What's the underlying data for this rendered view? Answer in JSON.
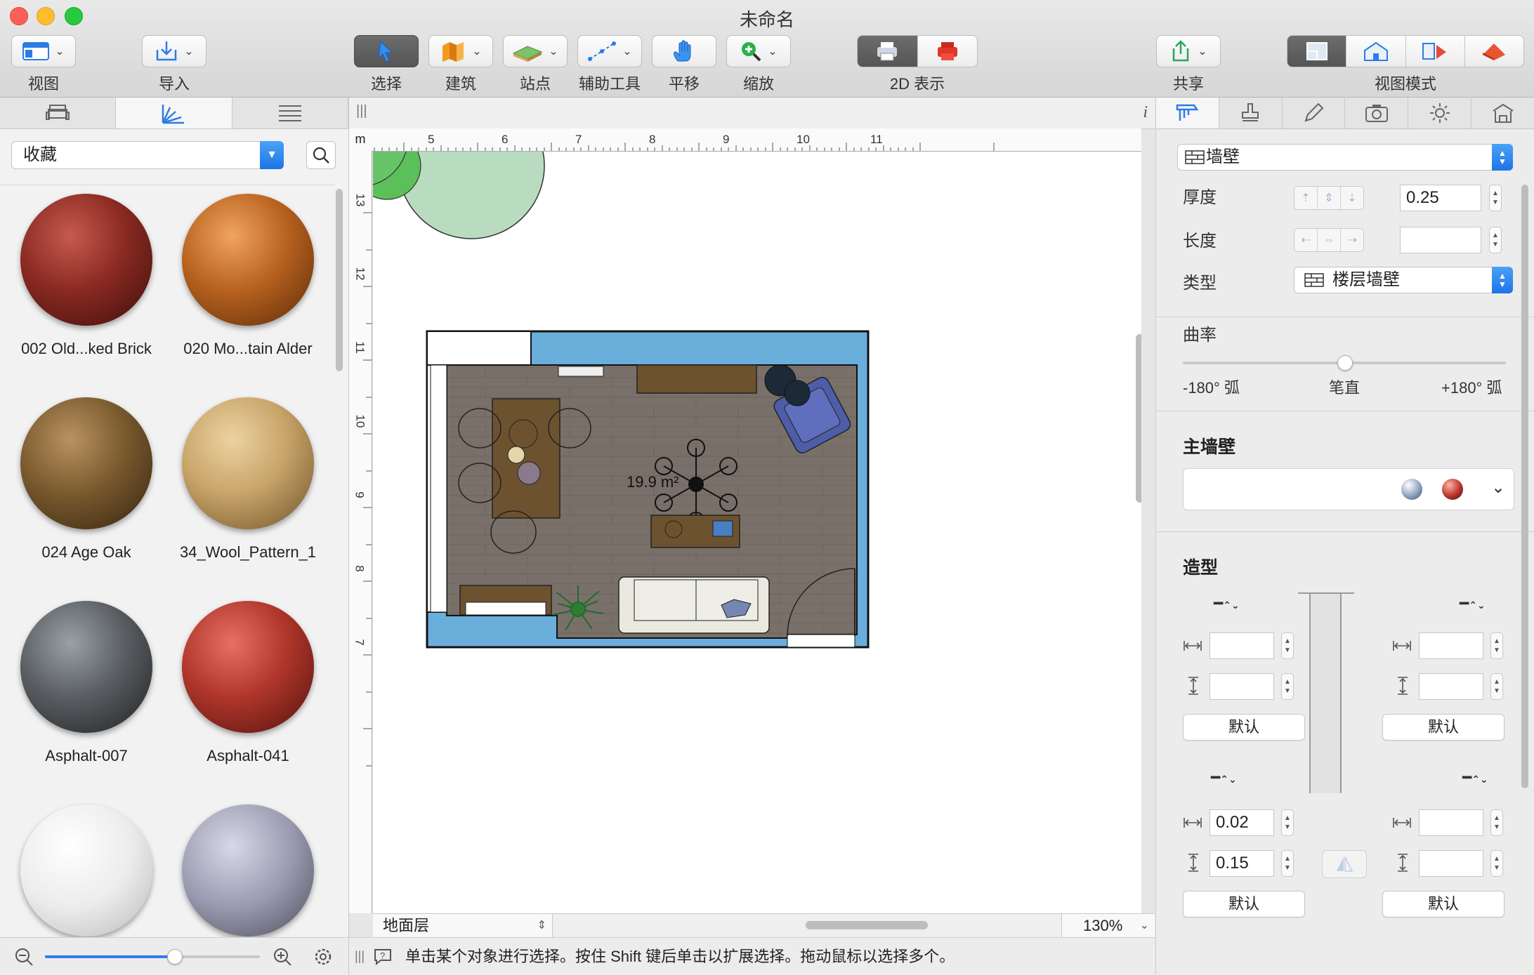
{
  "window": {
    "title": "未命名"
  },
  "toolbar": {
    "view_label": "视图",
    "import_label": "导入",
    "select_label": "选择",
    "build_label": "建筑",
    "site_label": "站点",
    "aux_label": "辅助工具",
    "pan_label": "平移",
    "zoom_label": "缩放",
    "display_label": "2D 表示",
    "share_label": "共享",
    "viewmode_label": "视图模式"
  },
  "left_panel": {
    "category": "收藏",
    "materials": [
      {
        "name": "002 Old...ked Brick",
        "color": "#8a2a22"
      },
      {
        "name": "020 Mo...tain Alder",
        "color": "#b8621f"
      },
      {
        "name": "024 Age Oak",
        "color": "#7a5a2e"
      },
      {
        "name": "34_Wool_Pattern_1",
        "color": "#c8a469"
      },
      {
        "name": "Asphalt-007",
        "color": "#5a5e62"
      },
      {
        "name": "Asphalt-041",
        "color": "#b0362b"
      },
      {
        "name": "",
        "color": "#ececec"
      },
      {
        "name": "",
        "color": "#9a9ab0"
      }
    ],
    "zoom_slider": 0.6
  },
  "canvas": {
    "ruler_unit": "m",
    "ruler_top": [
      "5",
      "6",
      "7",
      "8",
      "9",
      "10",
      "11"
    ],
    "ruler_left": [
      "13",
      "12",
      "11",
      "10",
      "9",
      "8",
      "7"
    ],
    "room_area": "19.9 m²",
    "level": "地面层",
    "zoom": "130%",
    "status_text": "单击某个对象进行选择。按住 Shift 键后单击以扩展选择。拖动鼠标以选择多个。"
  },
  "inspector": {
    "object_type": "墙壁",
    "thickness_label": "厚度",
    "thickness_value": "0.25",
    "length_label": "长度",
    "length_value": "",
    "type_label": "类型",
    "type_value": "楼层墙壁",
    "curvature_label": "曲率",
    "curvature_min": "-180° 弧",
    "curvature_mid": "笔直",
    "curvature_max": "+180° 弧",
    "curvature_value": 0.5,
    "main_wall_label": "主墙壁",
    "main_wall_colors": [
      "#8fa3bf",
      "#b8342a"
    ],
    "shape_label": "造型",
    "default_label": "默认",
    "bottom_left_width": "0.02",
    "bottom_left_height": "0.15"
  }
}
